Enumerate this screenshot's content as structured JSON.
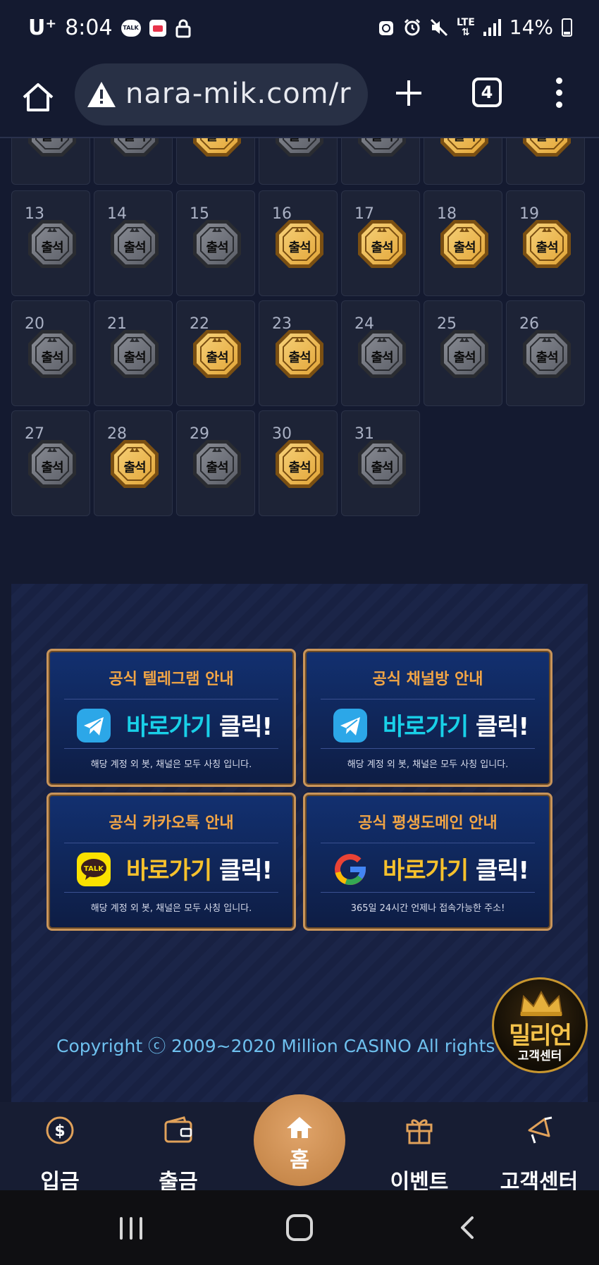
{
  "status_bar": {
    "carrier": "U⁺",
    "time": "8:04",
    "notification_icons": [
      "kakaotalk-icon",
      "calendar-icon",
      "lock-icon"
    ],
    "system_icons": [
      "recycle-icon",
      "alarm-icon",
      "mute-icon",
      "lte-icon",
      "signal-icon",
      "battery-icon"
    ],
    "lte": "LTE",
    "battery": "14%"
  },
  "browser": {
    "url": "nara-mik.com/r",
    "tab_count": "4"
  },
  "calendar": {
    "partial_row": {
      "attended": [
        false,
        false,
        true,
        false,
        false,
        true,
        true
      ]
    },
    "days": [
      {
        "day": "13",
        "attended": false
      },
      {
        "day": "14",
        "attended": false
      },
      {
        "day": "15",
        "attended": false
      },
      {
        "day": "16",
        "attended": true
      },
      {
        "day": "17",
        "attended": true
      },
      {
        "day": "18",
        "attended": true
      },
      {
        "day": "19",
        "attended": true
      },
      {
        "day": "20",
        "attended": false
      },
      {
        "day": "21",
        "attended": false
      },
      {
        "day": "22",
        "attended": true
      },
      {
        "day": "23",
        "attended": true
      },
      {
        "day": "24",
        "attended": false
      },
      {
        "day": "25",
        "attended": false
      },
      {
        "day": "26",
        "attended": false
      },
      {
        "day": "27",
        "attended": false
      },
      {
        "day": "28",
        "attended": true
      },
      {
        "day": "29",
        "attended": false
      },
      {
        "day": "30",
        "attended": true
      },
      {
        "day": "31",
        "attended": false
      }
    ],
    "badge_label": "출석",
    "colors": {
      "gold": "#e2a537",
      "gray": "#5a5d66"
    }
  },
  "banners": [
    {
      "title": "공식 텔레그램 안내",
      "icon": "telegram-icon",
      "cta_a": "바로가기",
      "cta_b": "클릭!",
      "note": "해당 계정 외 봇, 채널은 모두 사칭 입니다."
    },
    {
      "title": "공식 채널방 안내",
      "icon": "telegram-icon",
      "cta_a": "바로가기",
      "cta_b": "클릭!",
      "note": "해당 계정 외 봇, 채널은 모두 사칭 입니다."
    },
    {
      "title": "공식 카카오톡 안내",
      "icon": "kakaotalk-icon",
      "icon_text": "TALK",
      "cta_a": "바로가기",
      "cta_b": "클릭!",
      "note": "해당 계정 외 봇, 채널은 모두 사칭 입니다."
    },
    {
      "title": "공식 평생도메인 안내",
      "icon": "google-icon",
      "cta_a": "바로가기",
      "cta_b": "클릭!",
      "note": "365일 24시간 언제나 접속가능한 주소!"
    }
  ],
  "footer": {
    "copyright": "Copyright ⓒ 2009~2020 Million CASINO All rights rese"
  },
  "customer_center_badge": {
    "name": "밀리언",
    "sub": "고객센터"
  },
  "app_nav": {
    "deposit": "입금",
    "withdraw": "출금",
    "home": "홈",
    "event": "이벤트",
    "support": "고객센터"
  }
}
